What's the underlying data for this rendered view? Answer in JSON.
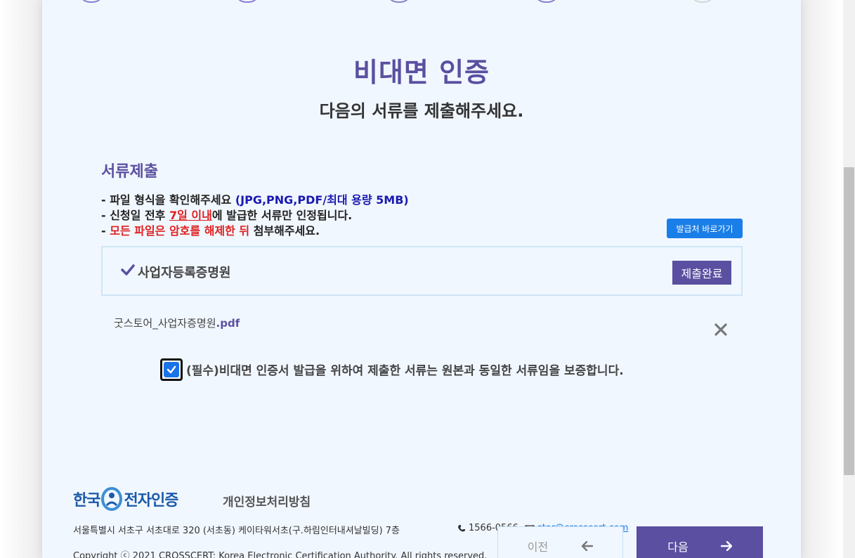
{
  "header": {
    "title": "비대면 인증",
    "subtitle": "다음의 서류를 제출해주세요."
  },
  "section": {
    "title": "서류제출",
    "notes": {
      "line1_prefix": "- 파일 형식을 확인해주세요 ",
      "line1_highlight": "(JPG,PNG,PDF/최대 용량 5MB)",
      "line2_prefix": "- 신청일 전후 ",
      "line2_highlight": "7일 이내",
      "line2_suffix": "에 발급한 서류만 인정됩니다.",
      "line3_prefix": "- ",
      "line3_highlight": "모든 파일은 암호를 해제한 뒤",
      "line3_suffix": " 첨부해주세요."
    },
    "issuer_button": "발급처 바로가기",
    "document": {
      "label": "사업자등록증명원",
      "status_button": "제출완료"
    },
    "file": {
      "name": "굿스토어_사업자증명원",
      "ext": ".pdf"
    },
    "agreement": {
      "checked": true,
      "label": "(필수)비대면 인증서 발급을 위하여 제출한 서류는 원본과 동일한 서류임을 보증합니다."
    }
  },
  "footer": {
    "logo_text_left": "한국",
    "logo_text_right": "전자인증",
    "privacy_link": "개인정보처리방침",
    "address": "서울특별시 서초구 서초대로 320 (서초동) 케이타워서초(구.하림인터내셔날빌딩) 7층",
    "phone": "1566-0566",
    "email": "star@crosscert.com",
    "copyright": "Copyright ⓒ 2021 CROSSCERT: Korea Electronic Certification Authority. All rights reserved."
  },
  "nav": {
    "prev_label": "이전",
    "next_label": "다음"
  },
  "colors": {
    "accent": "#5a4fa0",
    "link_blue": "#1a7ee8",
    "alert_red": "#e02020",
    "card_bg": "#f1f7ff"
  }
}
